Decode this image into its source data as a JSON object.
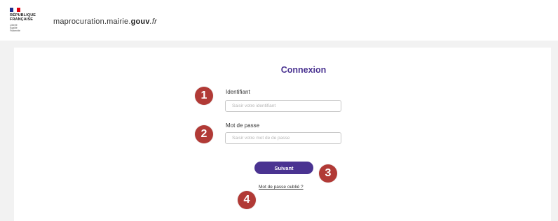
{
  "header": {
    "logo": {
      "flag_colors": [
        "#1f2f8c",
        "#ffffff",
        "#e1000f"
      ],
      "lines": [
        "RÉPUBLIQUE",
        "FRANÇAISE"
      ],
      "motto": [
        "Liberté",
        "Égalité",
        "Fraternité"
      ]
    },
    "site_name": {
      "prefix": "maprocuration.mairie.",
      "bold": "gouv",
      "suffix": ".fr"
    }
  },
  "login": {
    "title": "Connexion",
    "identifiant": {
      "label": "Identifiant",
      "placeholder": "Saisir votre identifiant"
    },
    "password": {
      "label": "Mot de passe",
      "placeholder": "Saisir votre mot de de passe"
    },
    "submit_label": "Suivant",
    "forgot_label": "Mot de passe oublié ?"
  },
  "annotations": [
    "1",
    "2",
    "3",
    "4"
  ],
  "colors": {
    "accent": "#4a3391",
    "badge": "#b13a36",
    "page_bg": "#f2f2f2"
  }
}
